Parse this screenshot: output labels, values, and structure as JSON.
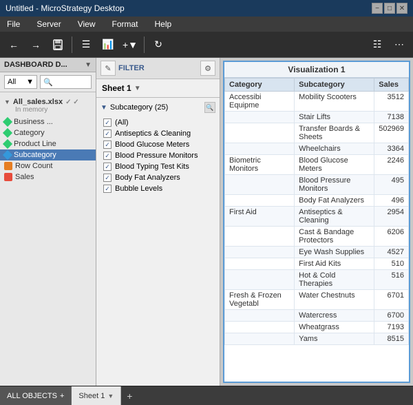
{
  "titleBar": {
    "title": "Untitled - MicroStrategy Desktop",
    "minimizeLabel": "−",
    "maximizeLabel": "□",
    "closeLabel": "✕"
  },
  "menuBar": {
    "items": [
      "File",
      "Server",
      "View",
      "Format",
      "Help"
    ]
  },
  "toolbar": {
    "buttons": [
      "←",
      "→",
      "💾",
      "≡↓",
      "📊",
      "+▾",
      "↻"
    ]
  },
  "leftPanel": {
    "header": "DASHBOARD D...",
    "allLabel": "All",
    "fileItem": {
      "name": "All_sales.xlsx",
      "sub": "In memory",
      "chevrons": "✓ ✓",
      "items": [
        "Business ...",
        "Category",
        "Product Line",
        "Subcategory",
        "Row Count",
        "Sales"
      ]
    }
  },
  "filterPanel": {
    "sheetLabel": "Sheet 1",
    "filterLabel": "FILTER",
    "subcategoryHeader": "Subcategory (25)",
    "items": [
      {
        "label": "(All)",
        "checked": true
      },
      {
        "label": "Antiseptics & Cleaning",
        "checked": true
      },
      {
        "label": "Blood Glucose Meters",
        "checked": true
      },
      {
        "label": "Blood Pressure Monitors",
        "checked": true
      },
      {
        "label": "Blood Typing Test Kits",
        "checked": true
      },
      {
        "label": "Body Fat Analyzers",
        "checked": true
      },
      {
        "label": "Bubble Levels",
        "checked": true
      }
    ]
  },
  "visualization": {
    "title": "Visualization 1",
    "columns": [
      "Category",
      "Subcategory",
      "Sales"
    ],
    "rows": [
      {
        "category": "Accessibi Equipme",
        "subcategory": "Mobility Scooters",
        "sales": "3512"
      },
      {
        "category": "",
        "subcategory": "Stair Lifts",
        "sales": "7138"
      },
      {
        "category": "",
        "subcategory": "Transfer Boards & Sheets",
        "sales": "502969"
      },
      {
        "category": "",
        "subcategory": "Wheelchairs",
        "sales": "3364"
      },
      {
        "category": "Biometric Monitors",
        "subcategory": "Blood Glucose Meters",
        "sales": "2246"
      },
      {
        "category": "",
        "subcategory": "Blood Pressure Monitors",
        "sales": "495"
      },
      {
        "category": "",
        "subcategory": "Body Fat Analyzers",
        "sales": "496"
      },
      {
        "category": "First Aid",
        "subcategory": "Antiseptics & Cleaning",
        "sales": "2954"
      },
      {
        "category": "",
        "subcategory": "Cast & Bandage Protectors",
        "sales": "6206"
      },
      {
        "category": "",
        "subcategory": "Eye Wash Supplies",
        "sales": "4527"
      },
      {
        "category": "",
        "subcategory": "First Aid Kits",
        "sales": "510"
      },
      {
        "category": "",
        "subcategory": "Hot & Cold Therapies",
        "sales": "516"
      },
      {
        "category": "Fresh & Frozen Vegetabl",
        "subcategory": "Water Chestnuts",
        "sales": "6701"
      },
      {
        "category": "",
        "subcategory": "Watercress",
        "sales": "6700"
      },
      {
        "category": "",
        "subcategory": "Wheatgrass",
        "sales": "7193"
      },
      {
        "category": "",
        "subcategory": "Yams",
        "sales": "8515"
      }
    ]
  },
  "bottomBar": {
    "allObjectsLabel": "ALL OBJECTS",
    "sheetLabel": "Sheet 1",
    "addLabel": "+"
  }
}
